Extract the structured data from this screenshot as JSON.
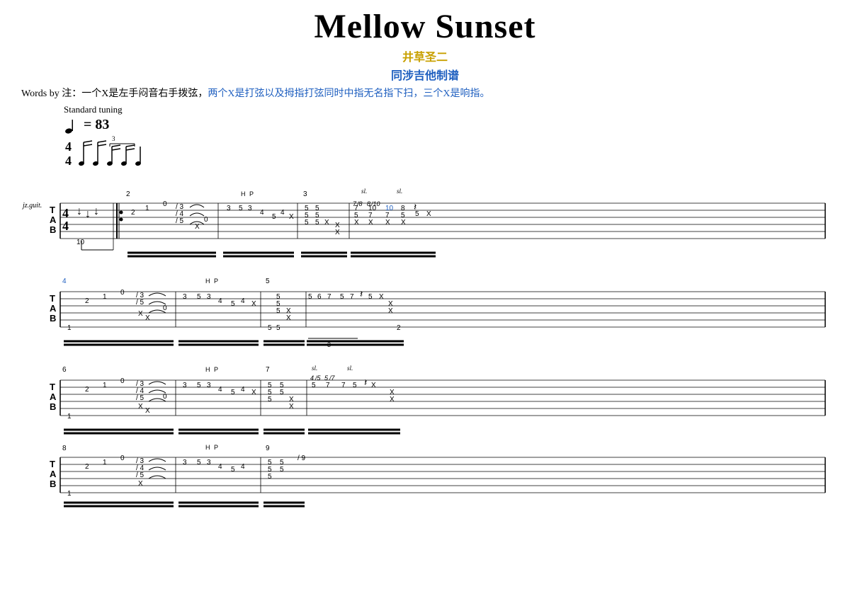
{
  "title": "Mellow Sunset",
  "subtitle_cn": "井草圣二",
  "subtitle_cn2": "同涉吉他制谱",
  "words_line": "Words by 注：一个X是左手闷音右手拨弦，",
  "words_line_blue": "两个X是打弦以及拇指打弦同时中指无名指下扫，三个X是响指。",
  "tuning": "Standard tuning",
  "tempo": "♩ = 83",
  "accent_color": "#c8a000",
  "blue_color": "#2060c0"
}
